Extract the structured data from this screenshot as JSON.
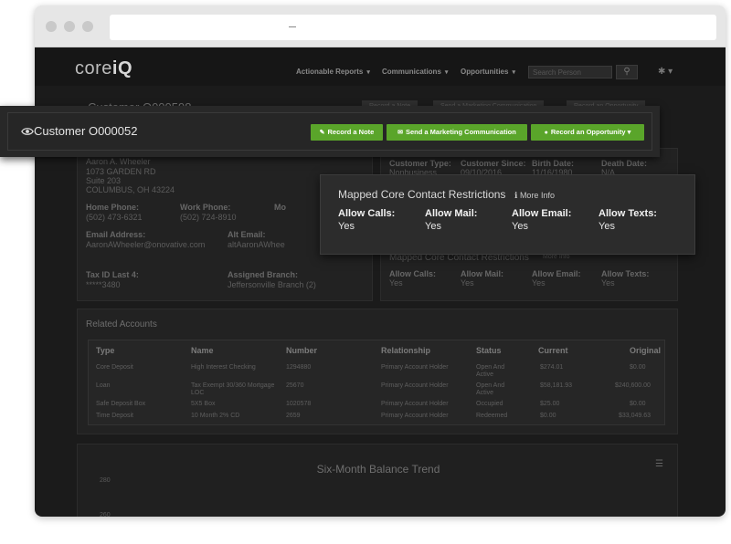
{
  "nav": {
    "logo_text": "core",
    "logo_bold": "iQ",
    "links": [
      {
        "label": "Actionable Reports"
      },
      {
        "label": "Communications"
      },
      {
        "label": "Opportunities"
      }
    ],
    "search_placeholder": "Search Person",
    "caret": "▾"
  },
  "bg_customer": {
    "title": "Customer O000598",
    "actions": [
      "Record a Note",
      "Send a Marketing Communication",
      "Record an Opportunity"
    ],
    "name_line": "Aaron A. Wheeler",
    "address1": "1073 GARDEN RD",
    "address2": "Suite 203",
    "city": "COLUMBUS, OH 43224",
    "home_phone_label": "Home Phone:",
    "home_phone": "(502) 473-6321",
    "work_phone_label": "Work Phone:",
    "work_phone": "(502) 724-8910",
    "mobile_label": "Mo",
    "email_label": "Email Address:",
    "email": "AaronAWheeler@onovative.com",
    "alt_email_label": "Alt Email:",
    "alt_email": "altAaronAWhee",
    "tax_label": "Tax ID Last 4:",
    "tax": "*****3480",
    "branch_label": "Assigned Branch:",
    "branch": "Jeffersonville Branch (2)",
    "type_label": "Customer Type:",
    "type_value": "Nonbusiness",
    "since_label": "Customer Since:",
    "since_value": "09/10/2016",
    "birth_label": "Birth Date:",
    "birth_value": "11/16/1980",
    "death_label": "Death Date:",
    "death_value": "N/A",
    "restrict_title": "Mapped Core Contact Restrictions",
    "restrict_more": "More Info",
    "restrict_labels": [
      "Allow Calls:",
      "Allow Mail:",
      "Allow Email:",
      "Allow Texts:"
    ],
    "restrict_values": [
      "Yes",
      "Yes",
      "Yes",
      "Yes"
    ]
  },
  "accounts": {
    "title": "Related Accounts",
    "headers": [
      "Type",
      "Name",
      "Number",
      "Relationship",
      "Status",
      "Current",
      "Original"
    ],
    "rows": [
      [
        "Core Deposit",
        "High Interest Checking",
        "1294880",
        "Primary Account Holder",
        "Open And Active",
        "$274.01",
        "$0.00"
      ],
      [
        "Loan",
        "Tax Exempt 30/360 Mortgage LOC",
        "25670",
        "Primary Account Holder",
        "Open And Active",
        "$58,181.93",
        "$240,600.00"
      ],
      [
        "Safe Deposit Box",
        "5X5 Box",
        "1020578",
        "Primary Account Holder",
        "Occupied",
        "$25.00",
        "$0.00"
      ],
      [
        "Time Deposit",
        "10 Month 2% CD",
        "2659",
        "Primary Account Holder",
        "Redeemed",
        "$0.00",
        "$33,049.63"
      ]
    ]
  },
  "chart": {
    "title": "Six-Month Balance Trend",
    "ticks": [
      "280",
      "260"
    ]
  },
  "strip": {
    "title": "Customer O000052",
    "buttons": [
      {
        "label": "Record a Note",
        "icon": "✎"
      },
      {
        "label": "Send a Marketing Communication",
        "icon": "✉"
      },
      {
        "label": "Record an Opportunity",
        "icon": "●",
        "caret": "▾"
      }
    ]
  },
  "restrictions": {
    "title": "Mapped Core Contact Restrictions",
    "more_info": "More Info",
    "items": [
      {
        "label": "Allow Calls:",
        "value": "Yes"
      },
      {
        "label": "Allow Mail:",
        "value": "Yes"
      },
      {
        "label": "Allow Email:",
        "value": "Yes"
      },
      {
        "label": "Allow Texts:",
        "value": "Yes"
      }
    ]
  },
  "colors": {
    "accent_green": "#5aa52a",
    "app_bg": "#1b1b1b"
  }
}
